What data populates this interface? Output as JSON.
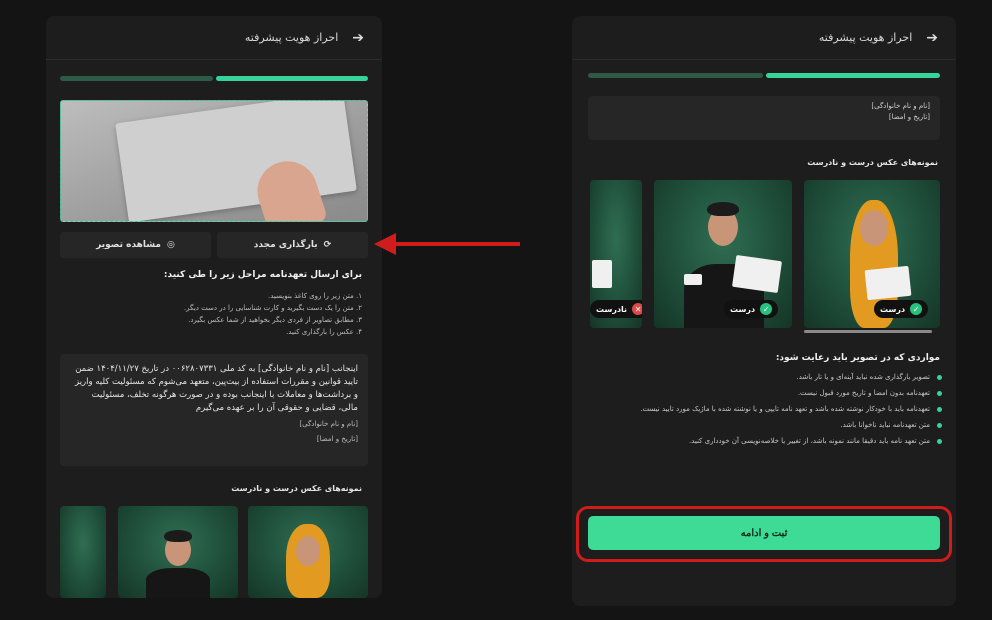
{
  "left_panel": {
    "header_title": "احراز هویت پیشرفته",
    "back_icon": "arrow-right-icon",
    "progress": {
      "steps_total": 2,
      "steps_done": 1
    },
    "reupload_label": "بارگذاری مجدد",
    "view_label": "مشاهده تصویر",
    "steps_title": "برای ارسال تعهدنامه مراحل زیر را طی کنید:",
    "steps": [
      "۱. متن زیر را روی کاغذ بنویسید.",
      "۲. متن را یک دست بگیرید و کارت شناسایی را در دست دیگر.",
      "۳. مطابق تصاویر از فردی دیگر بخواهید از شما عکس بگیرد.",
      "۴. عکس را بارگذاری کنید."
    ],
    "pledge_text": "اینجانب [نام و نام خانوادگی] به کد ملی ۰۰۶۲۸۰۷۳۳۱ در تاریخ ۱۴۰۴/۱۱/۲۷ ضمن تایید قوانین و مقررات استفاده از بیت‌پین، متعهد می‌شوم که مسئولیت کلیه واریز و برداشت‌ها و معاملات با اینجانب بوده و در صورت هرگونه تخلف، مسئولیت مالی، قضایی و حقوقی آن را بر عهده می‌گیرم",
    "pledge_name_line": "[نام و نام خانوادگی]",
    "pledge_date_line": "[تاریخ و امضا]",
    "samples_title": "نمونه‌های عکس درست و نادرست"
  },
  "right_panel": {
    "header_title": "احراز هویت پیشرفته",
    "back_icon": "arrow-right-icon",
    "progress": {
      "steps_total": 2,
      "steps_done": 1
    },
    "info_line1": "[نام و نام خانوادگی]",
    "info_line2": "[تاریخ و امضا]",
    "samples_title": "نمونه‌های عکس درست و نادرست",
    "badge_correct": "درست",
    "badge_wrong": "نادرست",
    "rules_title": "مواردی که در تصویر باید رعایت شود:",
    "rules": [
      "تصویر بارگذاری شده نباید آینه‌ای و یا تار باشد.",
      "تعهدنامه بدون امضا و تاریخ مورد قبول نیست.",
      "تعهدنامه باید با خودکار نوشته شده باشد و تعهد نامه تایپی و یا نوشته شده با ماژیک مورد تایید نیست.",
      "متن تعهدنامه نباید ناخوانا باشد.",
      "متن تعهد نامه باید دقیقا مانند نمونه باشد، از تغییر یا خلاصه‌نویسی آن خودداری کنید."
    ],
    "submit_label": "ثبت و ادامه"
  },
  "colors": {
    "accent": "#3ddb96",
    "annotation_red": "#d11c1c",
    "panel_bg": "#1d1d1d",
    "page_bg": "#141414"
  }
}
